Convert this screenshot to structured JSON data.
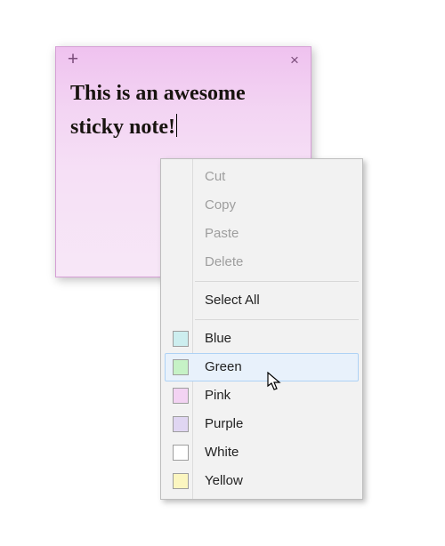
{
  "note": {
    "text": "This is an awesome sticky note!",
    "add_icon": "+",
    "close_icon": "×",
    "gradient_top": "#efc2ef",
    "gradient_bottom": "#f7e7f7"
  },
  "context_menu": {
    "disabled": [
      {
        "label": "Cut"
      },
      {
        "label": "Copy"
      },
      {
        "label": "Paste"
      },
      {
        "label": "Delete"
      }
    ],
    "select_all": "Select All",
    "colors": [
      {
        "label": "Blue",
        "swatch": "#cdeeef",
        "hover": false
      },
      {
        "label": "Green",
        "swatch": "#c6f2c6",
        "hover": true
      },
      {
        "label": "Pink",
        "swatch": "#f3d3f3",
        "hover": false
      },
      {
        "label": "Purple",
        "swatch": "#e0d6f2",
        "hover": false
      },
      {
        "label": "White",
        "swatch": "#ffffff",
        "hover": false
      },
      {
        "label": "Yellow",
        "swatch": "#fbf6c0",
        "hover": false
      }
    ]
  }
}
